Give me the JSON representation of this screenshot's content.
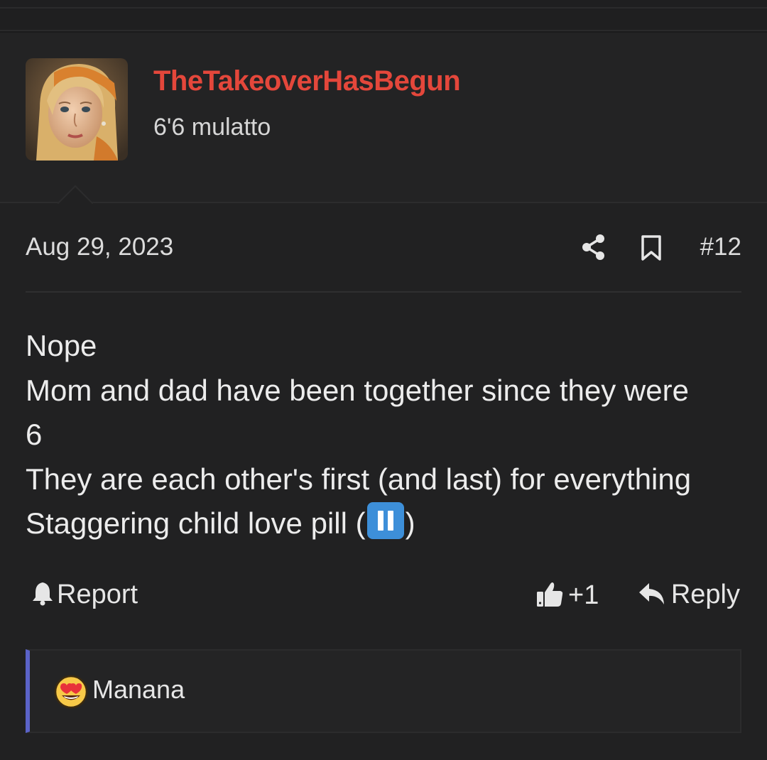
{
  "user": {
    "name": "TheTakeoverHasBegun",
    "title": "6'6 mulatto",
    "name_color": "#e4473b"
  },
  "post": {
    "date": "Aug 29, 2023",
    "number": "#12",
    "lines": [
      "Nope",
      "Mom and dad have been together since they were",
      "6",
      "They are each other's first (and last) for everything"
    ],
    "last_line_text": "Staggering child love pill (",
    "last_line_close": ")",
    "emoji": "pause-button-emoji"
  },
  "actions": {
    "report_label": "Report",
    "like_count": "+1",
    "reply_label": "Reply"
  },
  "reactions": {
    "emoji": "heart-eyes-emoji",
    "users": [
      "Manana"
    ],
    "accent_color": "#5b63c8"
  }
}
